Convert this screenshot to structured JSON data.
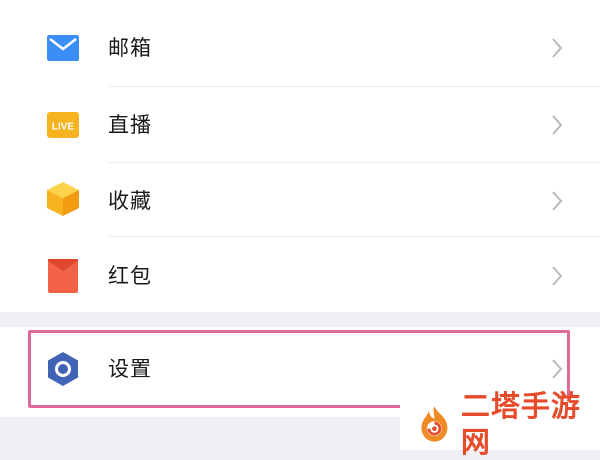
{
  "menu": {
    "items": [
      {
        "label": "邮箱",
        "icon": "mail-icon",
        "color": "#3a8ef5"
      },
      {
        "label": "直播",
        "icon": "live-icon",
        "color": "#f6b21f",
        "badge": "LIVE"
      },
      {
        "label": "收藏",
        "icon": "cube-icon",
        "color": "#f9c22b"
      },
      {
        "label": "红包",
        "icon": "red-envelope-icon",
        "color": "#f26246"
      },
      {
        "label": "设置",
        "icon": "settings-hex-icon",
        "color": "#3f64b5"
      }
    ]
  },
  "highlight_color": "#e0699a",
  "watermark": {
    "text": "二塔手游网",
    "color": "#e64b2b"
  }
}
